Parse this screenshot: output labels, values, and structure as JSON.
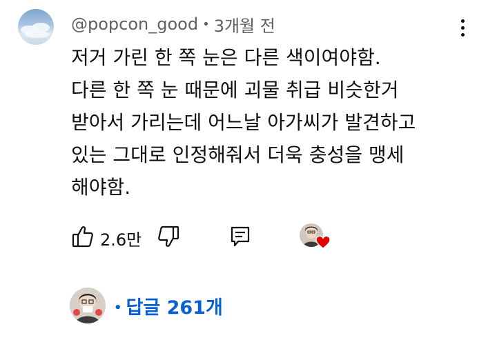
{
  "comment": {
    "author": "@popcon_good",
    "separator": "•",
    "time": "3개월 전",
    "lines": [
      "저거 가린 한 쪽 눈은 다른 색이여야함.",
      "다른 한 쪽 눈 때문에 괴물 취급 비슷한거",
      "받아서 가리는데 어느날 아가씨가 발견하고",
      "있는 그대로 인정해줘서 더욱 충성을 맹세",
      "해야함."
    ]
  },
  "actions": {
    "like_count": "2.6만"
  },
  "replies": {
    "separator": "•",
    "label": "답글 261개"
  },
  "icons": {
    "menu": "more-vert-icon",
    "like": "thumb-up-icon",
    "dislike": "thumb-down-icon",
    "reply": "reply-comment-icon",
    "creator_heart": "heart-icon"
  },
  "colors": {
    "text": "#0f0f0f",
    "meta": "#606060",
    "link": "#065fd4",
    "heart": "#e00000"
  }
}
